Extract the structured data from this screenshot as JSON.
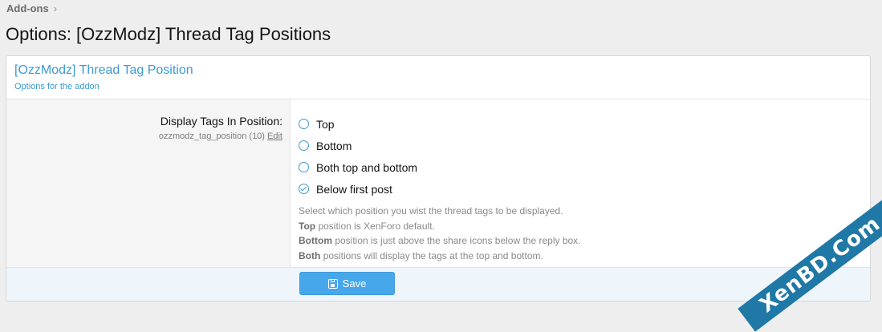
{
  "breadcrumb": {
    "item": "Add-ons"
  },
  "page": {
    "title": "Options: [OzzModz] Thread Tag Positions"
  },
  "block": {
    "title": "[OzzModz] Thread Tag Position",
    "description": "Options for the addon"
  },
  "option": {
    "label": "Display Tags In Position:",
    "hint_id": "ozzmodz_tag_position (10)",
    "hint_edit": "Edit",
    "choices": [
      {
        "label": "Top",
        "selected": false
      },
      {
        "label": "Bottom",
        "selected": false
      },
      {
        "label": "Both top and bottom",
        "selected": false
      },
      {
        "label": "Below first post",
        "selected": true
      }
    ],
    "explain": {
      "line1": "Select which position you wist the thread tags to be displayed.",
      "line2_bold": "Top",
      "line2_rest": " position is XenForo default.",
      "line3_bold": "Bottom",
      "line3_rest": " position is just above the share icons below the reply box.",
      "line4_bold": "Both",
      "line4_rest": " positions will display the tags at the top and bottom."
    }
  },
  "footer": {
    "save_label": "Save"
  },
  "watermark": {
    "text": "XenBD.Com"
  },
  "colors": {
    "accent": "#47a7eb",
    "link": "#3c9ad3",
    "watermark_bg": "#1f78a6"
  }
}
